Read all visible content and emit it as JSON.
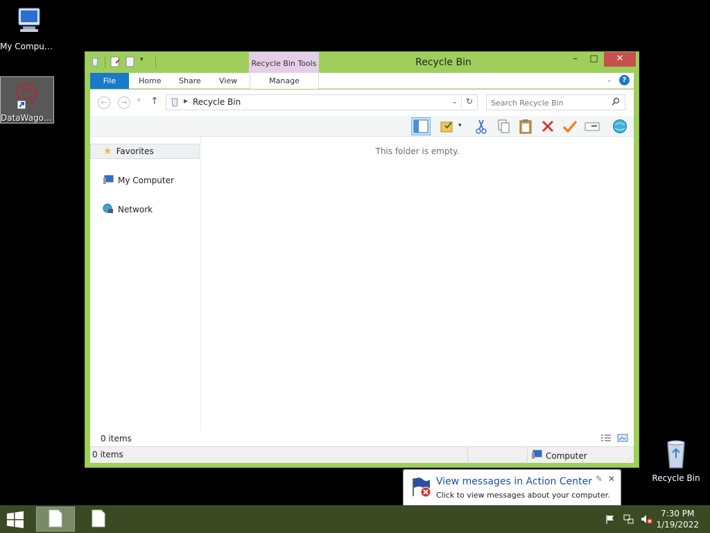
{
  "desktop": {
    "icons": [
      {
        "label": "My Computer"
      },
      {
        "label": "DataWagon..."
      },
      {
        "label": "Recycle Bin"
      }
    ]
  },
  "window": {
    "title": "Recycle Bin",
    "contextual_tab_group": "Recycle Bin Tools",
    "controls": {
      "minimize": "–",
      "maximize": "□",
      "close": "✕"
    },
    "ribbon_tabs": {
      "file": "File",
      "home": "Home",
      "share": "Share",
      "view": "View",
      "manage": "Manage"
    },
    "address": {
      "path": "Recycle Bin"
    },
    "search": {
      "placeholder": "Search Recycle Bin"
    },
    "nav_pane": {
      "favorites": "Favorites",
      "my_computer": "My Computer",
      "network": "Network"
    },
    "empty_message": "This folder is empty.",
    "item_count": "0 items",
    "status": {
      "items": "0 items",
      "zone": "Computer"
    }
  },
  "notification": {
    "title": "View messages in Action Center",
    "body": "Click to view messages about your computer."
  },
  "taskbar": {
    "time": "7:30 PM",
    "date": "1/19/2022"
  },
  "colors": {
    "window_frame": "#9ecf5c",
    "file_tab": "#1979ca",
    "contextual_tab": "#e5cfe8",
    "taskbar": "#3b4a22",
    "close_button": "#c7504b"
  }
}
